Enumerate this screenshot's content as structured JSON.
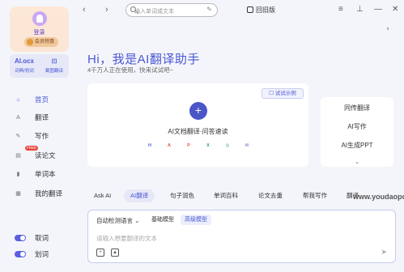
{
  "user": {
    "login": "登录",
    "badge": "会员特惠"
  },
  "tools": [
    {
      "glyph": "AI.ocx",
      "label": "词典/划词"
    },
    {
      "glyph": "⊡",
      "label": "截图翻译"
    }
  ],
  "nav": [
    {
      "label": "首页",
      "icon": "home-icon",
      "active": true
    },
    {
      "label": "翻译",
      "icon": "translate-icon"
    },
    {
      "label": "写作",
      "icon": "pen-icon"
    },
    {
      "label": "读论文",
      "icon": "paper-icon",
      "tag": "FREE"
    },
    {
      "label": "单词本",
      "icon": "book-icon"
    },
    {
      "label": "我的翻译",
      "icon": "folder-icon"
    }
  ],
  "toggles": [
    {
      "label": "取词",
      "on": true
    },
    {
      "label": "划词",
      "on": true
    }
  ],
  "topbar": {
    "search_placeholder": "输入单词或文本",
    "old_version": "回旧版"
  },
  "main": {
    "greeting": "Hi，我是AI翻译助手",
    "subgreeting": "4千万人正在使用，快来试试吧~",
    "example_button": "☐ 试试示例",
    "doc_title": "AI文档翻译·问答速读",
    "filetypes": [
      "H",
      "A",
      "P",
      "X",
      "◎",
      "✉"
    ],
    "side_items": [
      "同传翻译",
      "AI写作",
      "AI生成PPT"
    ],
    "side_more": "⌄"
  },
  "tabs": [
    "Ask AI",
    "AI翻译",
    "句子润色",
    "单词百科",
    "论文去重",
    "帮我写作",
    "翻译"
  ],
  "watermark": "www.youdaopc.cn",
  "input": {
    "language": "自动检测语言",
    "models": [
      "基础模型",
      "高级模型"
    ],
    "placeholder": "请输入想要翻译的文本"
  },
  "colors": {
    "accent": "#4957d6",
    "background": "#f4f5fa"
  }
}
